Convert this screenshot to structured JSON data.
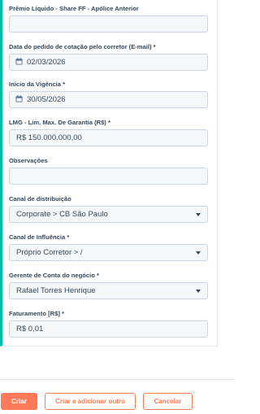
{
  "form": {
    "fields": [
      {
        "label": "Prêmio Líquido - Share FF - Apólice Anterior",
        "value": ""
      },
      {
        "label": "Data do pedido de cotação pelo corretor (E-mail) *",
        "value": "02/03/2026"
      },
      {
        "label": "Inicio da Vigência  *",
        "value": "30/05/2026"
      },
      {
        "label": "LMG - Lim. Max. De Garantia (R$) *",
        "value": "R$ 150.000.000,00"
      },
      {
        "label": "Observações",
        "value": ""
      },
      {
        "label": "Canal de distribuição",
        "value": "Corporate > CB São Paulo"
      },
      {
        "label": "Canal de Influência *",
        "value": "Próprio Corretor > /"
      },
      {
        "label": "Gerente de Conta do negócio *",
        "value": "Rafael Torres Henrique"
      },
      {
        "label": "Faturamento [R$] *",
        "value": "R$ 0,01"
      }
    ]
  },
  "footer": {
    "create_label": "Criar",
    "create_and_add_label": "Criar e adicionar outro",
    "cancel_label": "Cancelar"
  },
  "colors": {
    "accent": "#ff7a59",
    "panel_border": "#00bda5",
    "input_bg": "#f5f8fa",
    "input_border": "#cbd6e2"
  },
  "icons": {
    "date": "calendar-icon",
    "select": "chevron-down-icon"
  }
}
